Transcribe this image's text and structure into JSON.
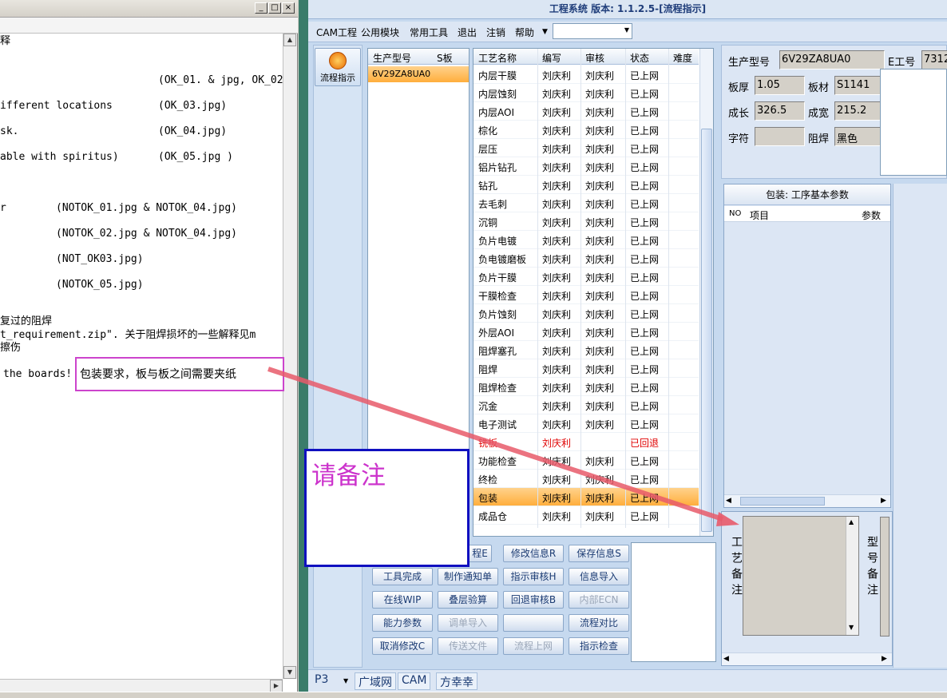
{
  "doc": {
    "lines": [
      "释",
      "(OK_01. & jpg, OK_02",
      "ifferent locations",
      "(OK_03.jpg)",
      "sk.",
      "(OK_04.jpg)",
      "able with spiritus)",
      "(OK_05.jpg )",
      "r",
      "(NOTOK_01.jpg & NOTOK_04.jpg)",
      "(NOTOK_02.jpg & NOTOK_04.jpg)",
      "(NOT_OK03.jpg)",
      "(NOTOK_05.jpg)",
      "复过的阻焊",
      "t_requirement.zip\". 关于阻焊损坏的一些解释见m",
      "擦伤",
      "the boards!"
    ],
    "pink_note": "包装要求，板与板之间需要夹纸",
    "blue_note": "请备注"
  },
  "app": {
    "title": "工程系统 版本: 1.1.2.5-[流程指示]",
    "menu": [
      "CAM工程",
      "公用模块",
      "常用工具",
      "退出",
      "注销",
      "帮助"
    ],
    "flow_button": "流程指示",
    "model_grid": {
      "headers": [
        "生产型号",
        "S板"
      ],
      "rows": [
        [
          "6V29ZA8UA0"
        ]
      ]
    },
    "process_grid": {
      "headers": [
        "工艺名称",
        "编写",
        "审核",
        "状态",
        "难度"
      ],
      "rows": [
        [
          "内层干膜",
          "刘庆利",
          "刘庆利",
          "已上网"
        ],
        [
          "内层蚀刻",
          "刘庆利",
          "刘庆利",
          "已上网"
        ],
        [
          "内层AOI",
          "刘庆利",
          "刘庆利",
          "已上网"
        ],
        [
          "棕化",
          "刘庆利",
          "刘庆利",
          "已上网"
        ],
        [
          "层压",
          "刘庆利",
          "刘庆利",
          "已上网"
        ],
        [
          "铝片钻孔",
          "刘庆利",
          "刘庆利",
          "已上网"
        ],
        [
          "钻孔",
          "刘庆利",
          "刘庆利",
          "已上网"
        ],
        [
          "去毛刺",
          "刘庆利",
          "刘庆利",
          "已上网"
        ],
        [
          "沉铜",
          "刘庆利",
          "刘庆利",
          "已上网"
        ],
        [
          "负片电镀",
          "刘庆利",
          "刘庆利",
          "已上网"
        ],
        [
          "负电镀磨板",
          "刘庆利",
          "刘庆利",
          "已上网"
        ],
        [
          "负片干膜",
          "刘庆利",
          "刘庆利",
          "已上网"
        ],
        [
          "干膜检查",
          "刘庆利",
          "刘庆利",
          "已上网"
        ],
        [
          "负片蚀刻",
          "刘庆利",
          "刘庆利",
          "已上网"
        ],
        [
          "外层AOI",
          "刘庆利",
          "刘庆利",
          "已上网"
        ],
        [
          "阻焊塞孔",
          "刘庆利",
          "刘庆利",
          "已上网"
        ],
        [
          "阻焊",
          "刘庆利",
          "刘庆利",
          "已上网"
        ],
        [
          "阻焊检查",
          "刘庆利",
          "刘庆利",
          "已上网"
        ],
        [
          "沉金",
          "刘庆利",
          "刘庆利",
          "已上网"
        ],
        [
          "电子测试",
          "刘庆利",
          "刘庆利",
          "已上网"
        ],
        [
          "铣板",
          "刘庆利",
          "",
          "已回退"
        ],
        [
          "功能检查",
          "刘庆利",
          "刘庆利",
          "已上网"
        ],
        [
          "终检",
          "刘庆利",
          "刘庆利",
          "已上网"
        ],
        [
          "包装",
          "刘庆利",
          "刘庆利",
          "已上网"
        ],
        [
          "成品仓",
          "刘庆利",
          "刘庆利",
          "已上网"
        ]
      ]
    },
    "buttons": [
      [
        "程E",
        "修改信息R",
        "保存信息S"
      ],
      [
        "工具完成",
        "制作通知单",
        "指示审核H",
        "信息导入"
      ],
      [
        "在线WIP",
        "叠层验算",
        "回退审核B",
        "内部ECN"
      ],
      [
        "能力参数",
        "调单导入",
        "",
        "流程对比"
      ],
      [
        "取消修改C",
        "传送文件",
        "流程上网",
        "指示检查"
      ]
    ],
    "info": {
      "model_label": "生产型号",
      "model_value": "6V29ZA8UA0",
      "e_label": "E工号",
      "e_value": "7312",
      "thickness_label": "板厚",
      "thickness_value": "1.05",
      "material_label": "板材",
      "material_value": "S1141",
      "length_label": "成长",
      "length_value": "326.5",
      "width_label": "成宽",
      "width_value": "215.2",
      "char_label": "字符",
      "char_value": "",
      "mask_label": "阻焊",
      "mask_value": "黑色"
    },
    "pkg": {
      "title": "包装: 工序基本参数",
      "headers": [
        "NO",
        "项目",
        "参数"
      ]
    },
    "remark_left": "工艺备注",
    "remark_right": "型号备注",
    "status_tabs": [
      "P3",
      "广域网",
      "CAM",
      "方幸幸"
    ]
  },
  "colors": {
    "accent_arrow": "#e85a6a",
    "selected_row": "#ffae3c",
    "rejected": "#e00000"
  }
}
